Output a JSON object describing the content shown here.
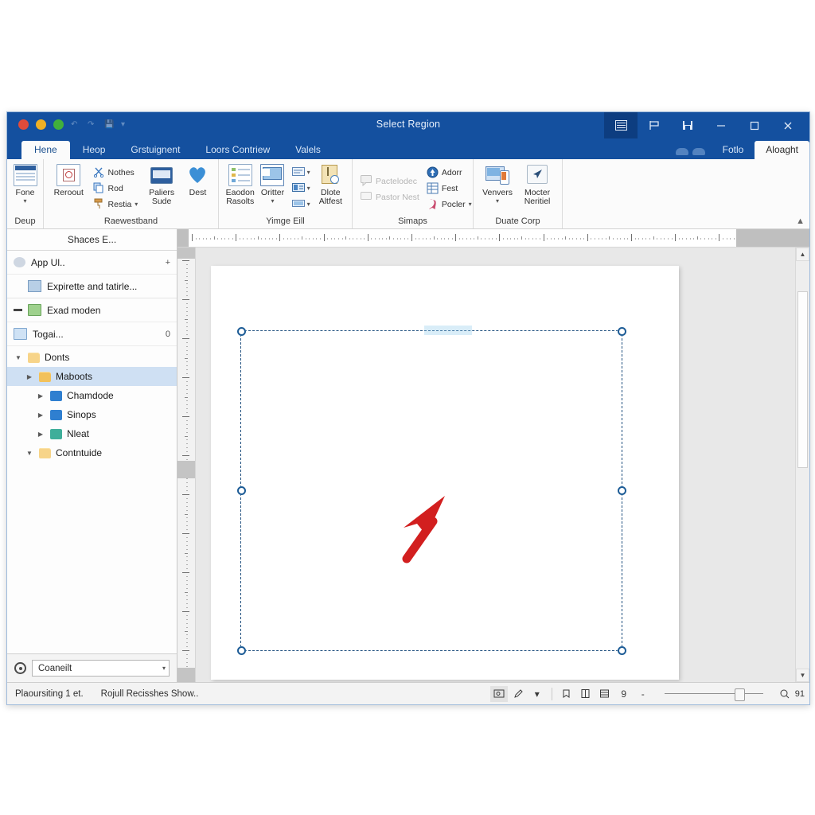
{
  "window": {
    "title": "Select Region",
    "traffic_lights": [
      {
        "name": "close",
        "color": "#e04b3a"
      },
      {
        "name": "minimize",
        "color": "#efb025"
      },
      {
        "name": "zoom",
        "color": "#41b03c"
      }
    ],
    "quick_access_icons": [
      "undo-icon",
      "redo-icon",
      "save-icon",
      "customize-icon"
    ],
    "controls": [
      {
        "name": "ribbon-display-options",
        "icon": "ribbon-menu-icon",
        "active": true
      },
      {
        "name": "presentation-view",
        "icon": "flag-icon",
        "active": false
      },
      {
        "name": "restore-down",
        "icon": "restore-icon",
        "active": false
      },
      {
        "name": "minimize",
        "icon": "minimize-icon",
        "active": false
      },
      {
        "name": "maximize",
        "icon": "maximize-icon",
        "active": false
      },
      {
        "name": "close",
        "icon": "close-icon",
        "active": false
      }
    ],
    "accent": "#14509f"
  },
  "tabs": {
    "items": [
      {
        "label": "Hene",
        "selected": true
      },
      {
        "label": "Heop",
        "selected": false
      },
      {
        "label": "Grstuignent",
        "selected": false
      },
      {
        "label": "Loors Contriew",
        "selected": false
      },
      {
        "label": "Valels",
        "selected": false
      }
    ],
    "right_items": [
      {
        "label": "Fotlo",
        "selected": false
      },
      {
        "label": "Aloaght",
        "selected": true
      }
    ]
  },
  "ribbon": {
    "collapse_icon": "chevron-up-icon",
    "groups": [
      {
        "label": "Deup",
        "big_buttons": [
          {
            "label": "Fone",
            "icon": "document-page-icon",
            "has_caret": true
          }
        ],
        "small_columns": []
      },
      {
        "label": "Raewestband",
        "big_buttons": [
          {
            "label": "Reroout",
            "icon": "paste-clipboard-icon",
            "has_caret": false
          }
        ],
        "small_columns": [
          [
            {
              "label": "Nothes",
              "icon": "scissors-icon",
              "has_caret": false,
              "dim": false
            },
            {
              "label": "Rod",
              "icon": "copy-icon",
              "has_caret": false,
              "dim": false
            },
            {
              "label": "Restia",
              "icon": "format-painter-icon",
              "has_caret": true,
              "dim": false
            }
          ]
        ],
        "extra_big": [
          {
            "label": "Paliers Sude",
            "icon": "layout-icon",
            "has_caret": false
          },
          {
            "label": "Dest",
            "icon": "heart-icon",
            "has_caret": false
          }
        ]
      },
      {
        "label": "Yimge Eill",
        "big_buttons": [
          {
            "label": "Eaodon Rasolts",
            "icon": "list-panel-icon",
            "has_caret": false
          },
          {
            "label": "Oritter",
            "icon": "monitor-icon",
            "has_caret": true
          },
          {
            "label": "Dlote Altfest",
            "icon": "page-refresh-icon",
            "has_caret": false
          }
        ],
        "small_columns": [
          [
            {
              "label": "",
              "icon": "shape-a-icon",
              "has_caret": true,
              "dim": false
            },
            {
              "label": "",
              "icon": "shape-b-icon",
              "has_caret": true,
              "dim": false
            },
            {
              "label": "",
              "icon": "shape-c-icon",
              "has_caret": true,
              "dim": false
            }
          ]
        ]
      },
      {
        "label": "Simaps",
        "big_buttons": [],
        "small_columns": [
          [
            {
              "label": "Pactelodec",
              "icon": "comment-icon",
              "has_caret": false,
              "dim": true
            },
            {
              "label": "Pastor Nest",
              "icon": "comment-alt-icon",
              "has_caret": false,
              "dim": true
            }
          ],
          [
            {
              "label": "Adorr",
              "icon": "circle-arrow-icon",
              "has_caret": false,
              "dim": false
            },
            {
              "label": "Fest",
              "icon": "table-icon",
              "has_caret": false,
              "dim": false
            },
            {
              "label": "Pocler",
              "icon": "ribbon-award-icon",
              "has_caret": true,
              "dim": false
            }
          ]
        ]
      },
      {
        "label": "Duate Corp",
        "big_buttons": [
          {
            "label": "Venvers",
            "icon": "devices-icon",
            "has_caret": true
          },
          {
            "label": "Mocter Neritiel",
            "icon": "pointer-arrow-icon",
            "has_caret": false
          }
        ],
        "small_columns": []
      }
    ]
  },
  "left_panel": {
    "title": "Shaces E...",
    "rows": [
      {
        "label": "App Ul..",
        "icon": "gearapp-icon",
        "tail": "+",
        "indent": false
      },
      {
        "label": "Expirette and tatirle...",
        "icon": "pic-icon",
        "tail": "",
        "indent": true
      },
      {
        "label": "Exad moden",
        "icon": "box-icon",
        "tail": "",
        "indent": false,
        "leading": "drag-handle-icon"
      },
      {
        "label": "Togai...",
        "icon": "drawer-icon",
        "tail": "0",
        "indent": false
      }
    ],
    "tree": [
      {
        "label": "Donts",
        "depth": 0,
        "twisty": "down",
        "icon": "folder-open-icon",
        "selected": false
      },
      {
        "label": "Maboots",
        "depth": 1,
        "twisty": "right",
        "icon": "folder-icon",
        "selected": true
      },
      {
        "label": "Chamdode",
        "depth": 2,
        "twisty": "right",
        "icon": "shirt-icon",
        "selected": false
      },
      {
        "label": "Sinops",
        "depth": 2,
        "twisty": "right",
        "icon": "shirt-icon",
        "selected": false
      },
      {
        "label": "Nleat",
        "depth": 2,
        "twisty": "right",
        "icon": "shirt-green-icon",
        "selected": false
      },
      {
        "label": "Contntuide",
        "depth": 1,
        "twisty": "down",
        "icon": "folder-open-icon",
        "selected": false
      }
    ],
    "bottom": {
      "gear_icon": "gear-icon",
      "combo_value": "Coaneilt",
      "combo_caret": "chevron-down-icon"
    }
  },
  "canvas": {
    "selection": {
      "handles": [
        "top-left",
        "top-right",
        "middle-left",
        "middle-right",
        "bottom-left",
        "bottom-right"
      ],
      "border_color": "#20507f",
      "handle_fill": "#ffffff"
    },
    "annotation": {
      "type": "arrow",
      "color": "#d21f1f",
      "name": "red-pointer-arrow"
    },
    "scrollbar": {
      "up_icon": "chevron-up-icon",
      "down_icon": "chevron-down-icon"
    }
  },
  "status_bar": {
    "left_items": [
      "Plaoursiting 1 et.",
      "Rojull Recisshes Show.."
    ],
    "view_buttons": [
      {
        "name": "normal-view",
        "icon": "normal-view-icon",
        "active": true
      },
      {
        "name": "reading-view",
        "icon": "pen-view-icon",
        "active": false
      },
      {
        "name": "view-caret",
        "icon": "chevron-down-icon",
        "active": false
      }
    ],
    "tool_buttons": [
      {
        "name": "tool-one",
        "icon": "note-icon"
      },
      {
        "name": "tool-two",
        "icon": "book-icon"
      },
      {
        "name": "tool-three",
        "icon": "layout-icon"
      },
      {
        "name": "tool-four",
        "icon": "number-icon"
      }
    ],
    "zoom_minus": "-",
    "zoom_value": "91",
    "zoom_percent": 91
  }
}
